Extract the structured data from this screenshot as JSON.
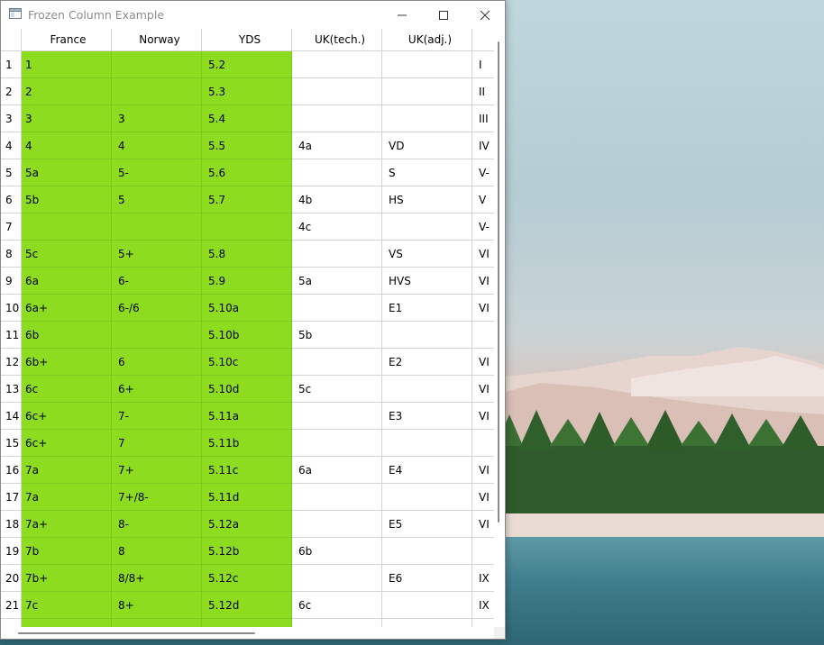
{
  "window": {
    "title": "Frozen Column Example"
  },
  "table": {
    "headers": [
      "France",
      "Norway",
      "YDS",
      "UK(tech.)",
      "UK(adj.)",
      ""
    ],
    "rows": [
      {
        "n": "1",
        "cells": [
          "1",
          "",
          "5.2",
          "",
          "",
          "I"
        ]
      },
      {
        "n": "2",
        "cells": [
          "2",
          "",
          "5.3",
          "",
          "",
          "II"
        ]
      },
      {
        "n": "3",
        "cells": [
          "3",
          "3",
          "5.4",
          "",
          "",
          "III"
        ]
      },
      {
        "n": "4",
        "cells": [
          "4",
          "4",
          "5.5",
          "4a",
          "VD",
          "IV"
        ]
      },
      {
        "n": "5",
        "cells": [
          "5a",
          "5-",
          "5.6",
          "",
          "S",
          "V-"
        ]
      },
      {
        "n": "6",
        "cells": [
          "5b",
          "5",
          "5.7",
          "4b",
          "HS",
          "V"
        ]
      },
      {
        "n": "7",
        "cells": [
          "",
          "",
          "",
          "4c",
          "",
          "V-"
        ]
      },
      {
        "n": "8",
        "cells": [
          "5c",
          "5+",
          "5.8",
          "",
          "VS",
          "VI"
        ]
      },
      {
        "n": "9",
        "cells": [
          "6a",
          "6-",
          "5.9",
          "5a",
          "HVS",
          "VI"
        ]
      },
      {
        "n": "10",
        "cells": [
          "6a+",
          "6-/6",
          "5.10a",
          "",
          "E1",
          "VI"
        ]
      },
      {
        "n": "11",
        "cells": [
          "6b",
          "",
          "5.10b",
          "5b",
          "",
          ""
        ]
      },
      {
        "n": "12",
        "cells": [
          "6b+",
          "6",
          "5.10c",
          "",
          "E2",
          "VI"
        ]
      },
      {
        "n": "13",
        "cells": [
          "6c",
          "6+",
          "5.10d",
          "5c",
          "",
          "VI"
        ]
      },
      {
        "n": "14",
        "cells": [
          "6c+",
          "7-",
          "5.11a",
          "",
          "E3",
          "VI"
        ]
      },
      {
        "n": "15",
        "cells": [
          "6c+",
          "7",
          "5.11b",
          "",
          "",
          ""
        ]
      },
      {
        "n": "16",
        "cells": [
          "7a",
          "7+",
          "5.11c",
          "6a",
          "E4",
          "VI"
        ]
      },
      {
        "n": "17",
        "cells": [
          "7a",
          "7+/8-",
          "5.11d",
          "",
          "",
          "VI"
        ]
      },
      {
        "n": "18",
        "cells": [
          "7a+",
          "8-",
          "5.12a",
          "",
          "E5",
          "VI"
        ]
      },
      {
        "n": "19",
        "cells": [
          "7b",
          "8",
          "5.12b",
          "6b",
          "",
          ""
        ]
      },
      {
        "n": "20",
        "cells": [
          "7b+",
          "8/8+",
          "5.12c",
          "",
          "E6",
          "IX"
        ]
      },
      {
        "n": "21",
        "cells": [
          "7c",
          "8+",
          "5.12d",
          "6c",
          "",
          "IX"
        ]
      },
      {
        "n": "",
        "cells": [
          "",
          "",
          "",
          "",
          "",
          ""
        ]
      }
    ]
  },
  "colors": {
    "frozen_column_bg": "#8edc1f",
    "grid_line": "#d4d4d4"
  },
  "icons": {
    "app": "window-app-icon",
    "minimize": "minimize-icon",
    "maximize": "maximize-icon",
    "close": "close-icon"
  }
}
